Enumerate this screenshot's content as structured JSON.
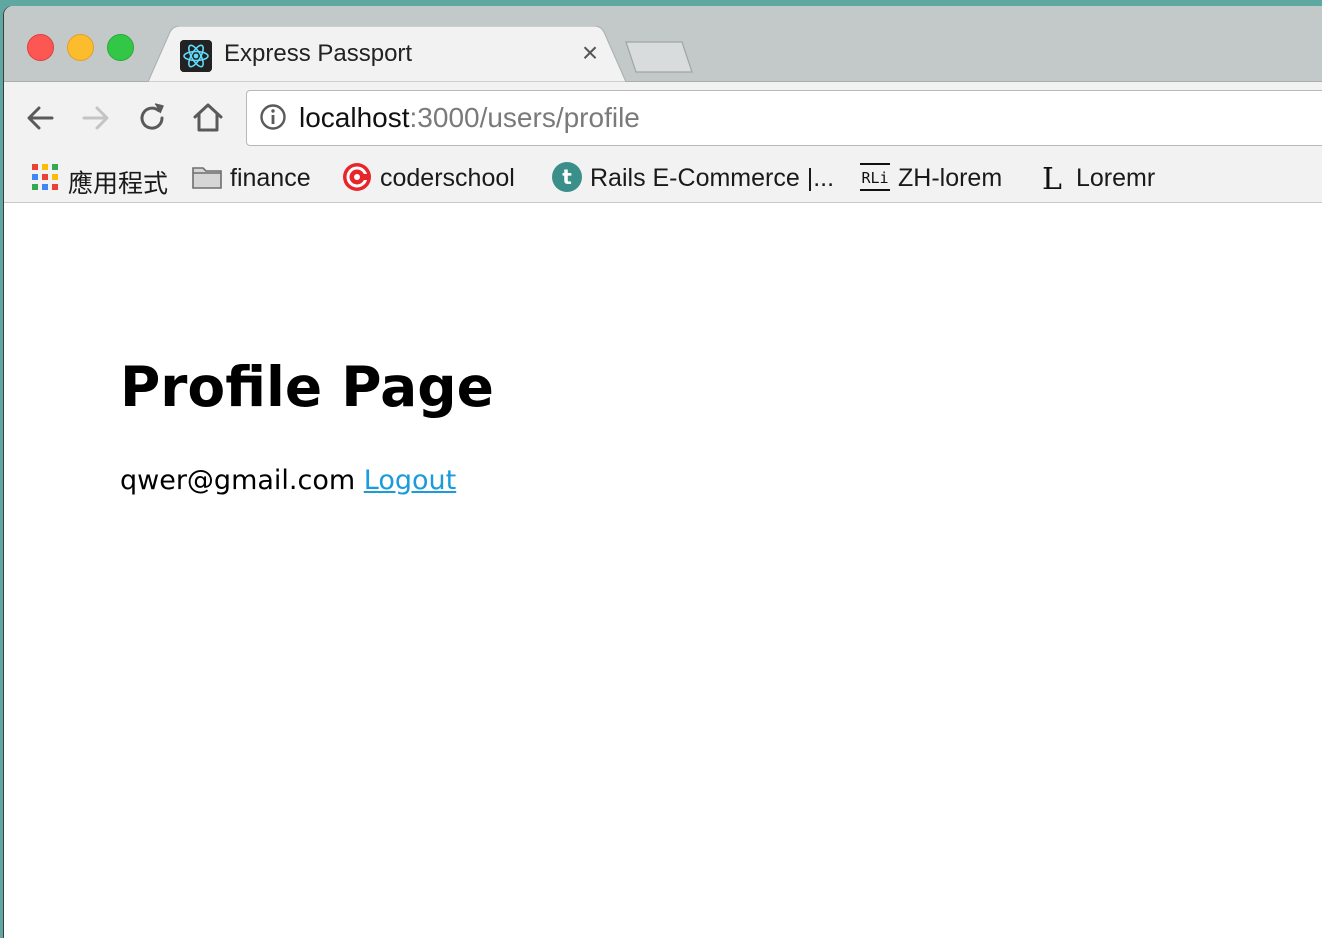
{
  "browser": {
    "tab": {
      "title": "Express Passport",
      "close_glyph": "×",
      "favicon": "react-icon"
    },
    "toolbar": {
      "back": "arrow-left-icon",
      "forward": "arrow-right-icon",
      "reload": "reload-icon",
      "home": "home-icon"
    },
    "address_bar": {
      "host": "localhost",
      "path": ":3000/users/profile",
      "info_icon": "info-icon"
    },
    "bookmarks": [
      {
        "label": "應用程式",
        "icon": "apps-grid-icon"
      },
      {
        "label": "finance",
        "icon": "folder-icon"
      },
      {
        "label": "coderschool",
        "icon": "coderschool-icon"
      },
      {
        "label": "Rails E-Commerce |...",
        "icon": "t-circle-icon"
      },
      {
        "label": "ZH-lorem",
        "icon": "rli-icon"
      },
      {
        "label": "Loremr",
        "icon": "l-letter-icon"
      }
    ]
  },
  "page": {
    "title": "Profile Page",
    "email": "qwer@gmail.com",
    "logout_label": "Logout"
  },
  "colors": {
    "link": "#1a9bdc",
    "close_button": "#fc5753",
    "minimize_button": "#fdbc2e",
    "maximize_button": "#33c748"
  }
}
